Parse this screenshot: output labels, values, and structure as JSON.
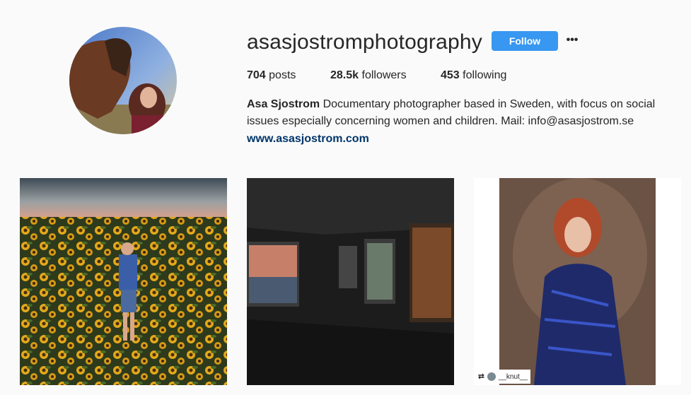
{
  "profile": {
    "username": "asasjostromphotography",
    "follow_label": "Follow",
    "more_label": "•••",
    "stats": {
      "posts_count": "704",
      "posts_label": " posts",
      "followers_count": "28.5k",
      "followers_label": " followers",
      "following_count": "453",
      "following_label": " following"
    },
    "bio": {
      "name": "Asa Sjostrom",
      "text": " Documentary photographer based in Sweden, with focus on social issues especially concerning women and children. Mail: info@asasjostrom.se",
      "link": "www.asasjostrom.com"
    }
  },
  "posts": [
    {
      "subject": "boy in sunflower field"
    },
    {
      "subject": "gallery exhibition photographs"
    },
    {
      "subject": "red-haired woman portrait",
      "repost_user": "__knut__",
      "repost_icon": "⮂"
    }
  ],
  "colors": {
    "accent": "#3897f0",
    "link": "#003569",
    "text": "#262626",
    "background": "#fafafa"
  }
}
